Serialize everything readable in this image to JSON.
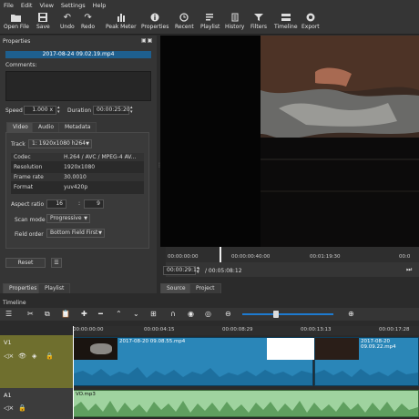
{
  "menu": [
    "File",
    "Edit",
    "View",
    "Settings",
    "Help"
  ],
  "toolbar": [
    {
      "label": "Open File",
      "icon": "folder-icon"
    },
    {
      "label": "Save",
      "icon": "save-icon"
    },
    {
      "label": "Undo",
      "icon": "undo-icon"
    },
    {
      "label": "Redo",
      "icon": "redo-icon"
    },
    {
      "label": "Peak Meter",
      "icon": "peak-meter-icon"
    },
    {
      "label": "Properties",
      "icon": "properties-icon"
    },
    {
      "label": "Recent",
      "icon": "recent-icon"
    },
    {
      "label": "Playlist",
      "icon": "playlist-icon"
    },
    {
      "label": "History",
      "icon": "history-icon"
    },
    {
      "label": "Filters",
      "icon": "filters-icon"
    },
    {
      "label": "Timeline",
      "icon": "timeline-icon"
    },
    {
      "label": "Export",
      "icon": "export-icon"
    }
  ],
  "properties": {
    "title": "Properties",
    "filename": "2017-08-24 09.02.19.mp4",
    "comments_label": "Comments:",
    "speed_label": "Speed",
    "speed_value": "1.000 x",
    "duration_label": "Duration",
    "duration_value": "00:00:25:20",
    "tabs": [
      "Video",
      "Audio",
      "Metadata"
    ],
    "track_label": "Track",
    "track_value": "1: 1920x1080 h264",
    "info": [
      {
        "key": "Codec",
        "value": "H.264 / AVC / MPEG-4 AV..."
      },
      {
        "key": "Resolution",
        "value": "1920x1080"
      },
      {
        "key": "Frame rate",
        "value": "30.0010"
      },
      {
        "key": "Format",
        "value": "yuv420p"
      }
    ],
    "aspect_label": "Aspect ratio",
    "aspect_w": "16",
    "aspect_sep": ":",
    "aspect_h": "9",
    "scan_label": "Scan mode",
    "scan_value": "Progressive",
    "field_label": "Field order",
    "field_value": "Bottom Field First",
    "reset": "Reset",
    "bottom_tabs": [
      "Properties",
      "Playlist"
    ]
  },
  "player": {
    "ruler": [
      "00:00:00:00",
      "00:00:00:40:00",
      "00:01:19:30",
      "00:0"
    ],
    "position": "00:00:29:12",
    "total": "/ 00:05:08:12",
    "tabs": [
      "Source",
      "Project"
    ]
  },
  "timeline": {
    "title": "Timeline",
    "ruler": [
      "00:00:00:00",
      "00:00:04:15",
      "00:00:08:29",
      "00:00:13:13",
      "00:00:17:28"
    ],
    "tracks": [
      {
        "name": "V1",
        "clips": [
          "2017-08-20 09.08.55.mp4",
          "2017-08-20 09.09.22.mp4"
        ]
      },
      {
        "name": "A1",
        "clips": [
          "VO.mp3"
        ]
      }
    ]
  },
  "colors": {
    "accent": "#1e5f8e",
    "video_clip": "#2a86b8",
    "audio_clip": "#9fd39f",
    "track_head": "#6f6f2e"
  }
}
